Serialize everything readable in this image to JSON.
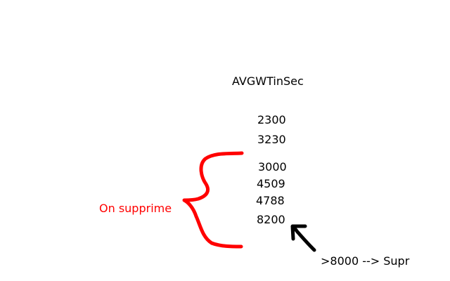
{
  "column_header": "AVGWTinSec",
  "values": [
    "2300",
    "3230",
    "3000",
    "4509",
    "4788",
    "8200"
  ],
  "annotations": {
    "left_note": "On supprime",
    "right_note": ">8000 --> Supr"
  },
  "colors": {
    "background": "#ffffff",
    "text": "#000000",
    "annotation_red": "#ff0000",
    "arrow": "#000000"
  },
  "icons": {
    "brace": "curly-brace-icon",
    "arrow": "arrow-up-left-icon"
  }
}
